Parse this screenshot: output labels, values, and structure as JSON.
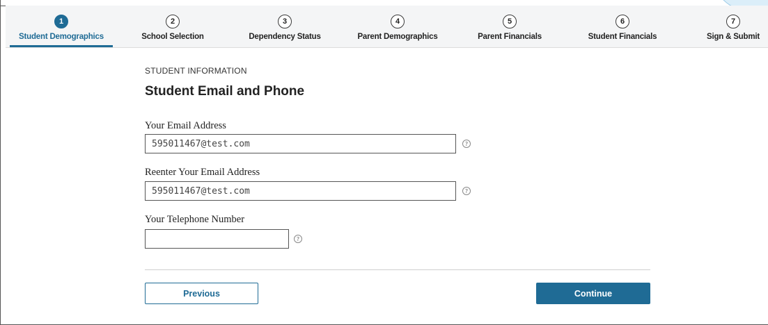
{
  "steps": [
    {
      "number": "1",
      "label": "Student Demographics"
    },
    {
      "number": "2",
      "label": "School Selection"
    },
    {
      "number": "3",
      "label": "Dependency Status"
    },
    {
      "number": "4",
      "label": "Parent Demographics"
    },
    {
      "number": "5",
      "label": "Parent Financials"
    },
    {
      "number": "6",
      "label": "Student Financials"
    },
    {
      "number": "7",
      "label": "Sign & Submit"
    }
  ],
  "active_step": "1",
  "section_label": "STUDENT INFORMATION",
  "page_title": "Student Email and Phone",
  "fields": {
    "email": {
      "label": "Your Email Address",
      "value": "595011467@test.com"
    },
    "email_confirm": {
      "label": "Reenter Your Email Address",
      "value": "595011467@test.com"
    },
    "phone": {
      "label": "Your Telephone Number",
      "value": ""
    }
  },
  "help_glyph": "?",
  "buttons": {
    "previous": "Previous",
    "continue": "Continue"
  },
  "colors": {
    "accent": "#1f6b95",
    "stepper_bg": "#f4f5f6"
  }
}
